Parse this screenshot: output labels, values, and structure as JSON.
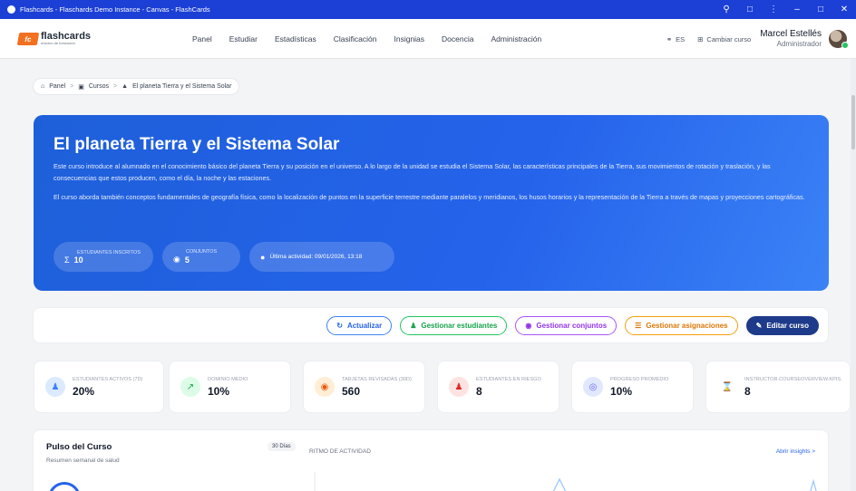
{
  "window": {
    "title": "Flashcards - Flaschards Demo Instance - Canvas - FlashCards"
  },
  "brand": {
    "name": "flashcards",
    "tagline": "entorno de formación",
    "badge": "fc",
    "color": "#f2701f"
  },
  "nav": [
    "Panel",
    "Estudiar",
    "Estadísticas",
    "Clasificación",
    "Insignias",
    "Docencia",
    "Administración"
  ],
  "header": {
    "lang": "ES",
    "switch_course": "Cambiar curso"
  },
  "user": {
    "name": "Marcel Estellés",
    "role": "Administrador"
  },
  "breadcrumb": [
    "Panel",
    "Cursos",
    "El planeta Tierra y el Sistema Solar"
  ],
  "hero": {
    "title": "El planeta Tierra y el Sistema Solar",
    "p1": "Este curso introduce al alumnado en el conocimiento básico del planeta Tierra y su posición en el universo. A lo largo de la unidad se estudia el Sistema Solar, las características principales de la Tierra, sus movimientos de rotación y traslación, y las consecuencias que estos producen, como el día, la noche y las estaciones.",
    "p2": "El curso aborda también conceptos fundamentales de geografía física, como la localización de puntos en la superficie terrestre mediante paralelos y meridianos, los husos horarios y la representación de la Tierra a través de mapas y proyecciones cartográficas.",
    "students_label": "ESTUDIANTES INSCRITOS",
    "students_value": "10",
    "sets_label": "CONJUNTOS",
    "sets_value": "5",
    "last_activity": "Última actividad: 09/01/2026, 13:18"
  },
  "actions": {
    "refresh": "Actualizar",
    "students": "Gestionar estudiantes",
    "sets": "Gestionar conjuntos",
    "assignments": "Gestionar asignaciones",
    "edit": "Editar curso"
  },
  "kpis": [
    {
      "label": "ESTUDIANTES ACTIVOS (7D)",
      "value": "20%",
      "icon": "users-icon",
      "color": "#3b82f6",
      "bg": "#dbeafe"
    },
    {
      "label": "DOMINIO MEDIO",
      "value": "10%",
      "icon": "chart-line-icon",
      "color": "#16a34a",
      "bg": "#dcfce7"
    },
    {
      "label": "TARJETAS REVISADAS (30D)",
      "value": "560",
      "icon": "eye-icon",
      "color": "#ea580c",
      "bg": "#ffedd5"
    },
    {
      "label": "ESTUDIANTES EN RIESGO",
      "value": "8",
      "icon": "user-warning-icon",
      "color": "#dc2626",
      "bg": "#fee2e2"
    },
    {
      "label": "PROGRESO PROMEDIO",
      "value": "10%",
      "icon": "target-icon",
      "color": "#6366f1",
      "bg": "#e0e7ff"
    },
    {
      "label": "INSTRUCTOR.COURSEOVERVIEW.KPIS.",
      "value": "8",
      "icon": "hourglass-icon",
      "color": "#dc2626",
      "bg": "#ffffff"
    }
  ],
  "pulse": {
    "title": "Pulso del Curso",
    "subtitle": "Resumen semanal de salud",
    "range": "30 Días",
    "rhythm": "RITMO DE ACTIVIDAD",
    "link": "Abrir insights"
  }
}
